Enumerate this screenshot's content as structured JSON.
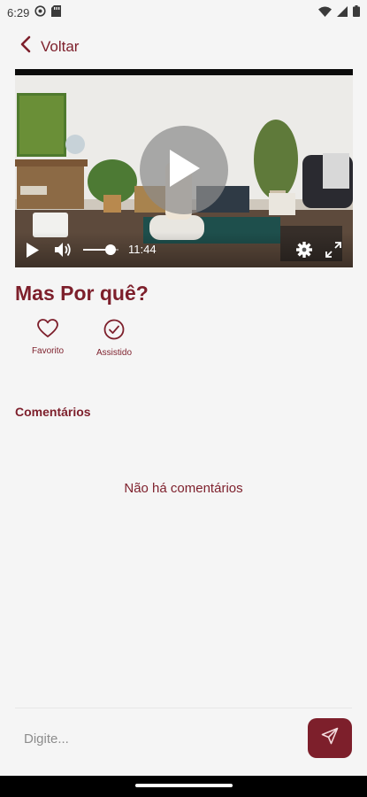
{
  "status_bar": {
    "time": "6:29"
  },
  "header": {
    "back_label": "Voltar"
  },
  "video": {
    "current_time": "11:44",
    "volume_level": 0.75
  },
  "content": {
    "title": "Mas Por quê?",
    "actions": {
      "favorite_label": "Favorito",
      "watched_label": "Assistido"
    },
    "comments_header": "Comentários",
    "empty_comments": "Não há comentários"
  },
  "composer": {
    "placeholder": "Digite..."
  },
  "colors": {
    "accent": "#7d1f2b",
    "background": "#f5f5f5"
  }
}
